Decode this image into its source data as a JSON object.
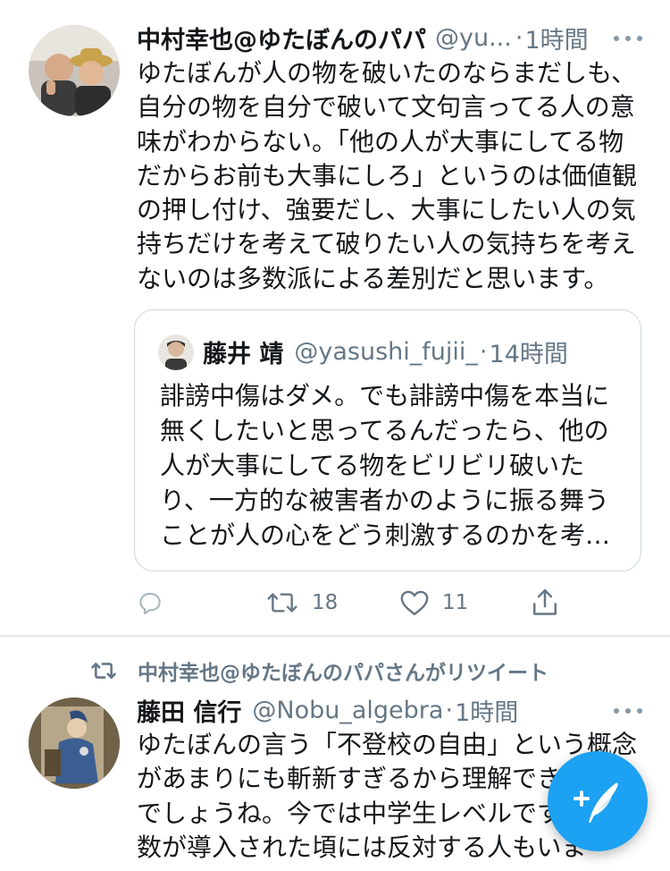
{
  "tweet1": {
    "name": "中村幸也@ゆたぼんのパパ",
    "handle": "@yu...",
    "sep": "·",
    "time": "1時間",
    "lines": [
      "ゆたぼんが人の物を破いたのならまだしも、",
      "自分の物を自分で破いて文句言ってる人の意",
      "味がわからない。「他の人が大事にしてる物",
      "だからお前も大事にしろ」というのは価値観",
      "の押し付け、強要だし、大事にしたい人の気",
      "持ちだけを考えて破りたい人の気持ちを考え",
      "ないのは多数派による差別だと思います。"
    ],
    "quote": {
      "name": "藤井 靖",
      "handle": "@yasushi_fujii_",
      "sep": "·",
      "time": "14時間",
      "lines": [
        "誹謗中傷はダメ。でも誹謗中傷を本当に",
        "無くしたいと思ってるんだったら、他の",
        "人が大事にしてる物をビリビリ破いた",
        "り、一方的な被害者かのように振る舞う",
        "ことが人の心をどう刺激するのかを考…"
      ]
    },
    "actions": {
      "retweets": "18",
      "likes": "11"
    }
  },
  "tweet2": {
    "retweet_label": "中村幸也@ゆたぼんのパパさんがリツイート",
    "name": "藤田 信行",
    "handle": "@Nobu_algebra",
    "sep": "·",
    "time": "1時間",
    "lines": [
      "ゆたぼんの言う「不登校の自由」という概念",
      "があまりにも斬新すぎるから理解でき",
      "でしょうね。今では中学生レベルです",
      "数が導入された頃には反対する人もいま"
    ]
  },
  "icons": {
    "more": "more-dots-icon",
    "reply": "reply-icon",
    "retweet": "retweet-icon",
    "like": "heart-icon",
    "share": "share-icon",
    "compose": "compose-tweet-icon"
  },
  "colors": {
    "accent": "#1da1f2",
    "secondary_text": "#657786",
    "border": "#ccd6dd"
  }
}
